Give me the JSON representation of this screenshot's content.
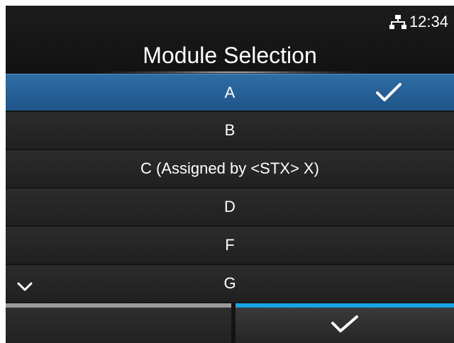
{
  "status": {
    "network_icon": "network-icon",
    "time": "12:34"
  },
  "header": {
    "title": "Module Selection"
  },
  "list": {
    "items": [
      {
        "label": "A",
        "selected": true,
        "checked": true
      },
      {
        "label": "B",
        "selected": false,
        "checked": false
      },
      {
        "label": "C (Assigned by <STX> X)",
        "selected": false,
        "checked": false
      },
      {
        "label": "D",
        "selected": false,
        "checked": false
      },
      {
        "label": "F",
        "selected": false,
        "checked": false
      },
      {
        "label": "G",
        "selected": false,
        "checked": false
      }
    ],
    "scroll_indicator_icon": "chevron-down-icon"
  },
  "bottom_bar": {
    "left_icon": "none",
    "right_icon": "checkmark-icon"
  },
  "colors": {
    "selected_row": "#1f5488",
    "accent_bar": "#1aa3e6",
    "left_bar": "#9a9a9a",
    "background": "#141414"
  }
}
